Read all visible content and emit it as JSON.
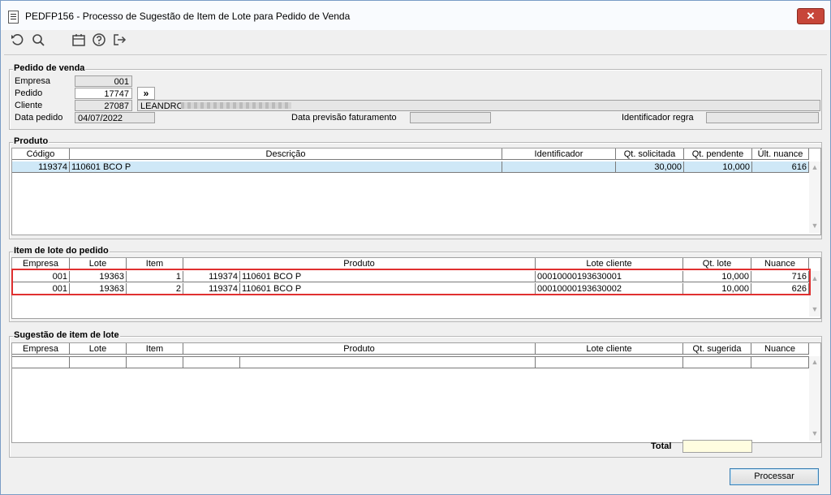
{
  "window": {
    "title": "PEDFP156 - Processo de Sugestão de Item de Lote para Pedido de Venda",
    "close_glyph": "✕"
  },
  "toolbar": {
    "icons": [
      "undo-icon",
      "search-icon",
      "calendar-icon",
      "help-icon",
      "exit-icon"
    ]
  },
  "pedido": {
    "legend": "Pedido de venda",
    "empresa_label": "Empresa",
    "empresa_value": "001",
    "pedido_label": "Pedido",
    "pedido_value": "17747",
    "nav_glyph": "»",
    "cliente_label": "Cliente",
    "cliente_code": "27087",
    "cliente_name": "LEANDRO",
    "data_pedido_label": "Data pedido",
    "data_pedido_value": "04/07/2022",
    "previsao_label": "Data previsão faturamento",
    "previsao_value": "",
    "ident_regra_label": "Identificador regra",
    "ident_regra_value": ""
  },
  "produto": {
    "legend": "Produto",
    "columns": [
      "Código",
      "Descrição",
      "Identificador",
      "Qt. solicitada",
      "Qt. pendente",
      "Últ. nuance"
    ],
    "rows": [
      [
        "119374",
        "110601 BCO P",
        "",
        "30,000",
        "10,000",
        "616"
      ]
    ]
  },
  "itemlote": {
    "legend": "Item de lote do pedido",
    "columns": [
      "Empresa",
      "Lote",
      "Item",
      "Produto",
      "Lote cliente",
      "Qt. lote",
      "Nuance"
    ],
    "rows": [
      [
        "001",
        "19363",
        "1",
        "119374",
        "110601 BCO P",
        "00010000193630001",
        "10,000",
        "716"
      ],
      [
        "001",
        "19363",
        "2",
        "119374",
        "110601 BCO P",
        "00010000193630002",
        "10,000",
        "626"
      ]
    ]
  },
  "sugestao": {
    "legend": "Sugestão de item de lote",
    "columns": [
      "Empresa",
      "Lote",
      "Item",
      "Produto",
      "Lote cliente",
      "Qt. sugerida",
      "Nuance"
    ],
    "total_label": "Total",
    "total_value": ""
  },
  "footer": {
    "process_label": "Processar"
  },
  "colors": {
    "selected_row": "#cfe8f7",
    "highlight_border": "#e03030",
    "total_field": "#fffde0",
    "close_button": "#c7463a"
  }
}
